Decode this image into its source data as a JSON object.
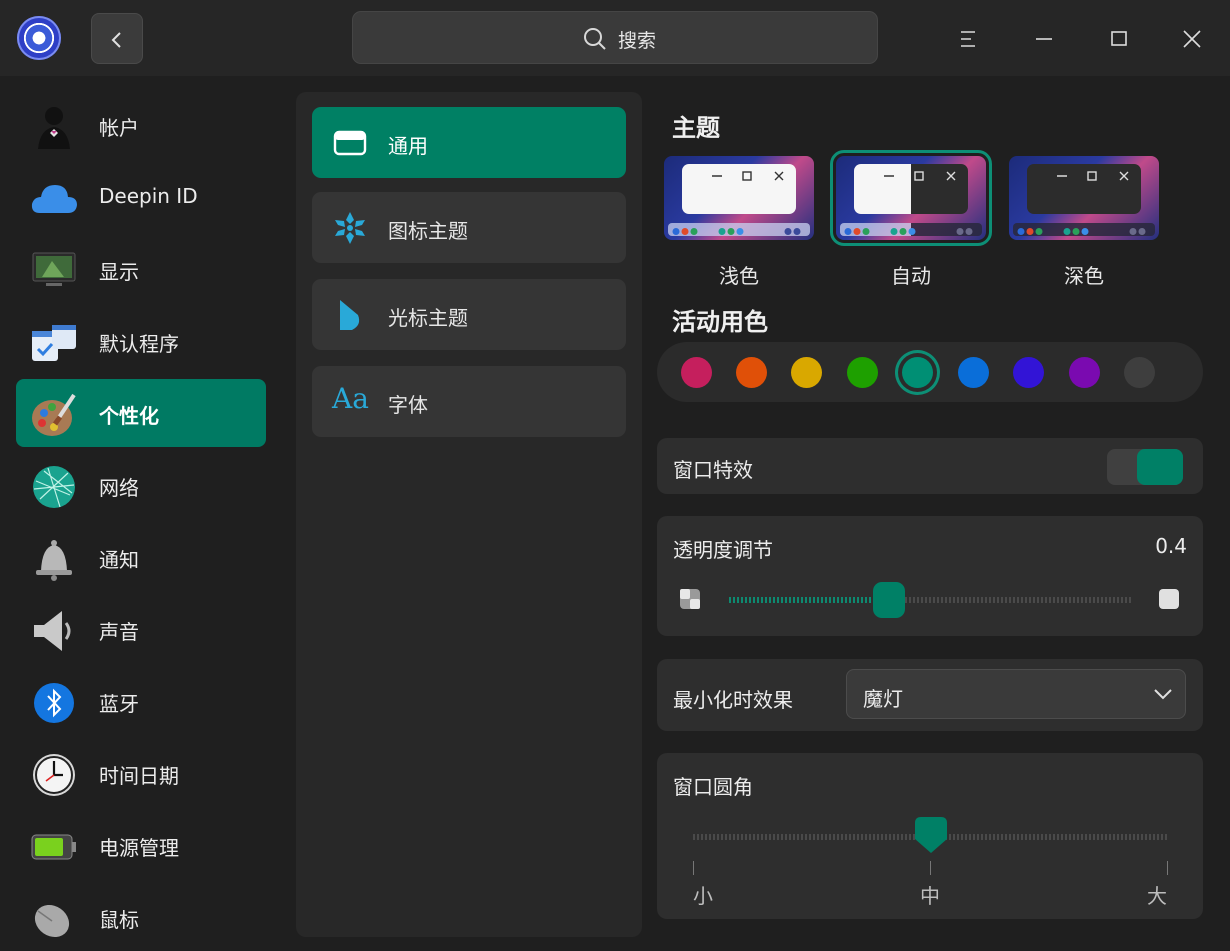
{
  "titlebar": {
    "search_label": "搜索"
  },
  "sidebar": {
    "items": [
      {
        "label": "帐户"
      },
      {
        "label": "Deepin ID"
      },
      {
        "label": "显示"
      },
      {
        "label": "默认程序"
      },
      {
        "label": "个性化"
      },
      {
        "label": "网络"
      },
      {
        "label": "通知"
      },
      {
        "label": "声音"
      },
      {
        "label": "蓝牙"
      },
      {
        "label": "时间日期"
      },
      {
        "label": "电源管理"
      },
      {
        "label": "鼠标"
      }
    ],
    "active": "个性化"
  },
  "subnav": {
    "items": [
      {
        "label": "通用"
      },
      {
        "label": "图标主题"
      },
      {
        "label": "光标主题"
      },
      {
        "label": "字体"
      }
    ],
    "font_icon_text": "Aa",
    "active": "通用"
  },
  "content": {
    "theme_title": "主题",
    "themes": [
      {
        "label": "浅色"
      },
      {
        "label": "自动"
      },
      {
        "label": "深色"
      }
    ],
    "selected_theme": "自动",
    "accent_title": "活动用色",
    "accent_colors": [
      "#c51f5d",
      "#e05008",
      "#d9a800",
      "#1ea000",
      "#008f74",
      "#0a6ed9",
      "#3214d6",
      "#7a0ab0",
      "#3e3e3e"
    ],
    "selected_accent": "#008f74",
    "window_effects": {
      "label": "窗口特效",
      "enabled": true
    },
    "transparency": {
      "label": "透明度调节",
      "value": "0.4",
      "fraction": 0.4
    },
    "minimize_effect": {
      "label": "最小化时效果",
      "value": "魔灯"
    },
    "corner": {
      "label": "窗口圆角",
      "ticks": [
        "小",
        "中",
        "大"
      ],
      "selected": "中"
    }
  },
  "colors": {
    "accent": "#008066",
    "bg": "#1f1f1f"
  }
}
